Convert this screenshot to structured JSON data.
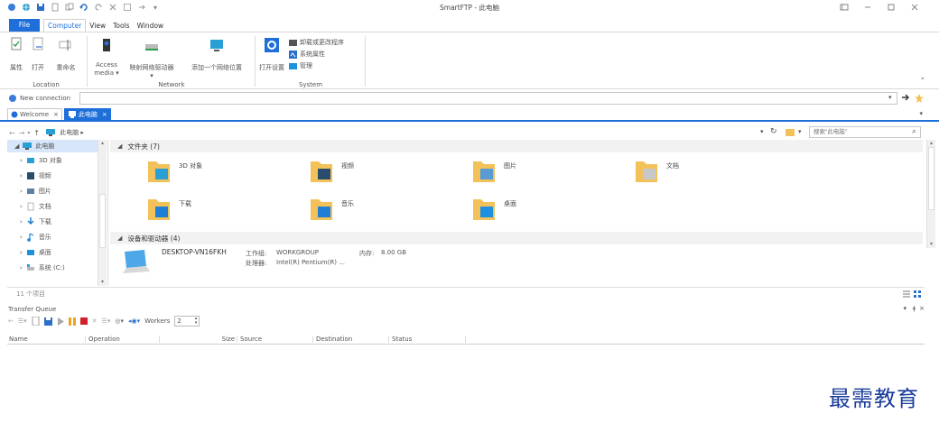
{
  "window": {
    "title": "SmartFTP - 此电脑",
    "controls": [
      "restore-icon",
      "minimize-icon",
      "maximize-icon",
      "close-icon"
    ]
  },
  "menu": {
    "file": "File",
    "items": [
      "Computer",
      "View",
      "Tools",
      "Window"
    ]
  },
  "ribbon": {
    "groups": [
      {
        "name": "Location",
        "buttons": [
          "属性",
          "打开",
          "重命名"
        ]
      },
      {
        "name": "Network",
        "buttons": [
          "Access media ▾",
          "映射网络驱动器",
          "添加一个网络位置"
        ]
      },
      {
        "name": "System",
        "buttons": [
          "打开设置",
          "卸载或更改程序",
          "系统属性",
          "管理"
        ]
      }
    ]
  },
  "connection": {
    "label": "New connection",
    "value": ""
  },
  "tabs": [
    {
      "label": "Welcome",
      "active": false
    },
    {
      "label": "此电脑",
      "active": true
    }
  ],
  "breadcrumb": {
    "path": "此电脑 ▸",
    "search_placeholder": "搜索\"此电脑\""
  },
  "tree": [
    {
      "label": "此电脑",
      "icon": "computer-icon",
      "expanded": true
    },
    {
      "label": "3D 对象",
      "icon": "3d-objects-icon"
    },
    {
      "label": "视频",
      "icon": "video-folder-icon"
    },
    {
      "label": "图片",
      "icon": "pictures-folder-icon"
    },
    {
      "label": "文档",
      "icon": "documents-folder-icon"
    },
    {
      "label": "下载",
      "icon": "downloads-folder-icon"
    },
    {
      "label": "音乐",
      "icon": "music-folder-icon"
    },
    {
      "label": "桌面",
      "icon": "desktop-folder-icon"
    },
    {
      "label": "系统 (C:)",
      "icon": "drive-icon"
    }
  ],
  "folders_header": "文件夹 (7)",
  "folders": [
    {
      "label": "3D 对象",
      "overlay": "#2a9fd6"
    },
    {
      "label": "视频",
      "overlay": "#2a4d6e"
    },
    {
      "label": "图片",
      "overlay": "#5b9bd5"
    },
    {
      "label": "文档",
      "overlay": "#c8c8c8"
    },
    {
      "label": "下载",
      "overlay": "#1e7fd4"
    },
    {
      "label": "音乐",
      "overlay": "#1e7fd4"
    },
    {
      "label": "桌面",
      "overlay": "#1e90e0"
    }
  ],
  "devices_header": "设备和驱动器 (4)",
  "device": {
    "name": "DESKTOP-VN16FKH",
    "workgroup_label": "工作组:",
    "workgroup_value": "WORKGROUP",
    "memory_label": "内存:",
    "memory_value": "8.00 GB",
    "cpu_label": "处理器:",
    "cpu_value": "Intel(R) Pentium(R) ..."
  },
  "status_bar": {
    "count": "11 个项目"
  },
  "transfer_queue": {
    "title": "Transfer Queue",
    "workers_label": "Workers",
    "workers_value": "2",
    "columns": [
      "Name",
      "Operation",
      "Size",
      "Source",
      "Destination",
      "Status"
    ]
  },
  "watermark": "最需教育",
  "colors": {
    "accent": "#1e6fd9",
    "folder": "#f2c15a",
    "tab_active": "#1e6fd9",
    "watermark": "#1a3c9c"
  }
}
